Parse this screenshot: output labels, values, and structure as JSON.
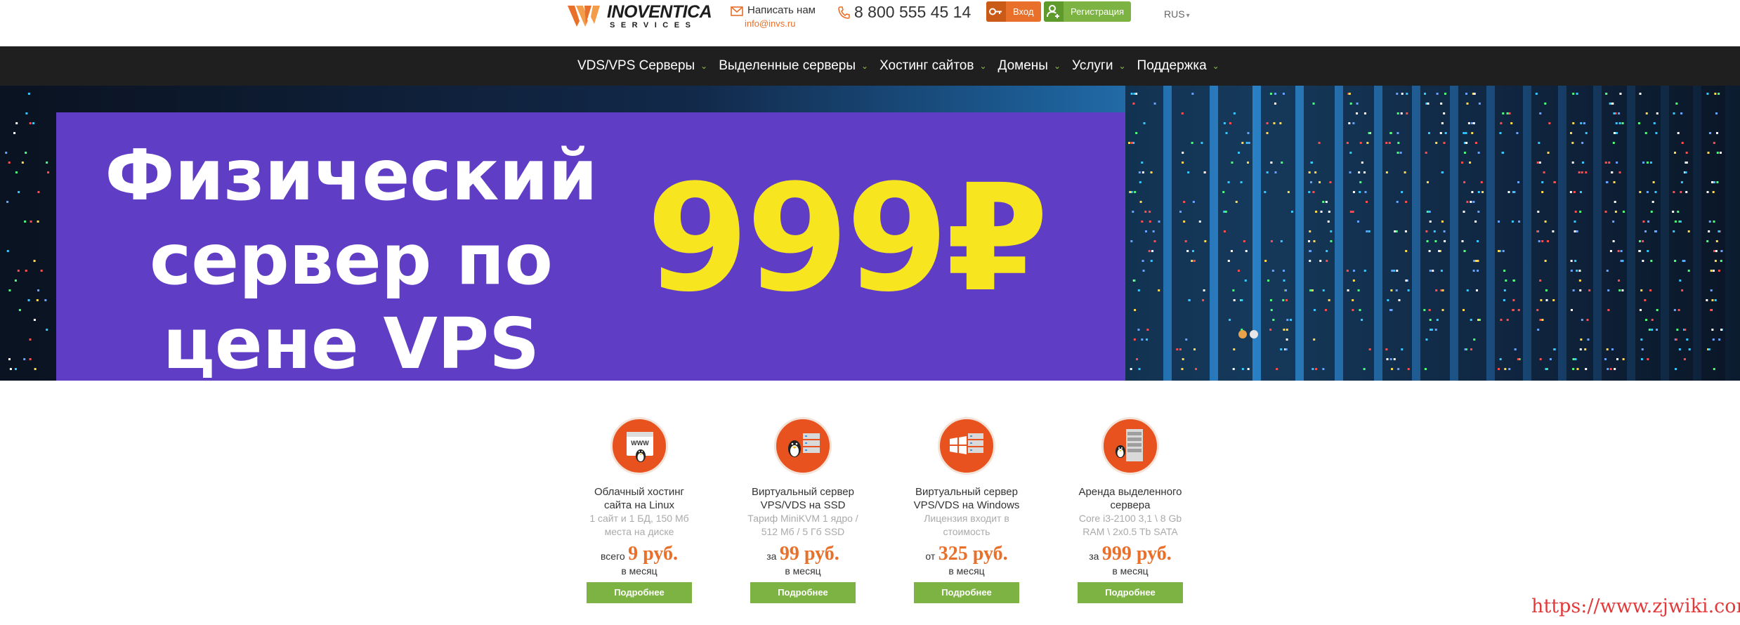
{
  "header": {
    "logo_name": "INOVENTICA",
    "logo_sub": "SERVICES",
    "contact_label": "Написать нам",
    "contact_email": "info@invs.ru",
    "phone": "8 800 555 45 14",
    "login_label": "Вход",
    "register_label": "Регистрация",
    "language": "RUS"
  },
  "nav": {
    "items": [
      {
        "label": "VDS/VPS Серверы"
      },
      {
        "label": "Выделенные серверы"
      },
      {
        "label": "Хостинг сайтов"
      },
      {
        "label": "Домены"
      },
      {
        "label": "Услуги"
      },
      {
        "label": "Поддержка"
      }
    ]
  },
  "banner": {
    "title": "Физический\nсервер по\nцене VPS",
    "price": "999₽",
    "slide_count": 2,
    "active_slide": 1
  },
  "offers": [
    {
      "icon": "www-linux-icon",
      "title": "Облачный хостинг сайта на Linux",
      "desc": "1 сайт и 1 БД, 150 Мб места на диске",
      "price_prefix": "всего",
      "price": "9 руб.",
      "period": "в месяц",
      "button": "Подробнее"
    },
    {
      "icon": "linux-server-icon",
      "title": "Виртуальный сервер VPS/VDS на SSD",
      "desc": "Тариф MiniKVM 1 ядро / 512 Мб / 5 Гб SSD",
      "price_prefix": "за",
      "price": "99 руб.",
      "period": "в месяц",
      "button": "Подробнее"
    },
    {
      "icon": "windows-server-icon",
      "title": "Виртуальный сервер VPS/VDS на Windows",
      "desc": "Лицензия входит в стоимость",
      "price_prefix": "от",
      "price": "325 руб.",
      "period": "в месяц",
      "button": "Подробнее"
    },
    {
      "icon": "dedicated-server-icon",
      "title": "Аренда выделенного сервера",
      "desc": "Core i3-2100 3,1 \\ 8 Gb RAM \\ 2x0.5 Tb SATA",
      "price_prefix": "за",
      "price": "999 руб.",
      "period": "в месяц",
      "button": "Подробнее"
    }
  ],
  "watermark": "https://www.zjwiki.com",
  "colors": {
    "accent_orange": "#e8702a",
    "accent_green": "#7cb342",
    "promo_purple": "#5f3dc4",
    "price_yellow": "#f7e51f",
    "nav_bg": "#1f1f1f"
  }
}
